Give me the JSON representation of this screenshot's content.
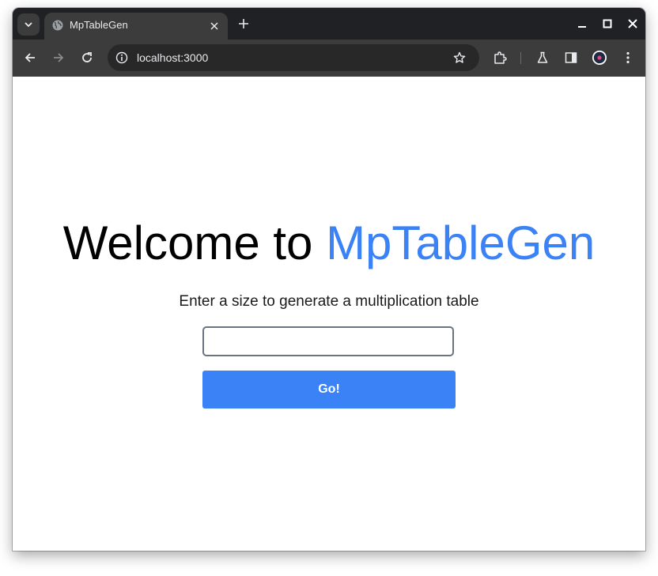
{
  "browser": {
    "tab": {
      "title": "MpTableGen"
    },
    "address_bar": {
      "url": "localhost:3000"
    },
    "colors": {
      "frame": "#202124",
      "toolbar": "#3c3c3c",
      "omnibox": "#282828",
      "icon": "#e8eaed"
    },
    "icons": [
      "tab-search-icon",
      "globe-icon",
      "close-icon",
      "plus-icon",
      "minimize-icon",
      "maximize-icon",
      "close-window-icon",
      "back-arrow-icon",
      "forward-arrow-icon",
      "reload-icon",
      "info-icon",
      "star-icon",
      "extensions-icon",
      "flask-icon",
      "side-panel-icon",
      "profile-icon",
      "more-vert-icon"
    ]
  },
  "page": {
    "heading": {
      "prefix": "Welcome to ",
      "brand": "MpTableGen"
    },
    "subtitle": "Enter a size to generate a multiplication table",
    "size_input": {
      "value": "",
      "placeholder": ""
    },
    "go_button": "Go!",
    "colors": {
      "accent": "#3b82f6",
      "input_border": "#6b7280"
    }
  }
}
